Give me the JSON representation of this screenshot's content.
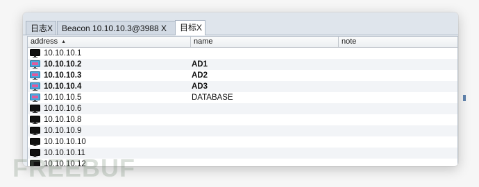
{
  "tabs": [
    {
      "label": "日志X"
    },
    {
      "label": "Beacon 10.10.10.3@3988   X"
    },
    {
      "label": "目标X"
    }
  ],
  "table": {
    "columns": [
      {
        "label": "address",
        "sort": "ascending"
      },
      {
        "label": "name"
      },
      {
        "label": "note"
      }
    ],
    "rows": [
      {
        "address": "10.10.10.1",
        "name": "",
        "note": "",
        "icon": "monitor-icon",
        "bold": false
      },
      {
        "address": "10.10.10.2",
        "name": "AD1",
        "note": "",
        "icon": "compromised-monitor-icon",
        "bold": true
      },
      {
        "address": "10.10.10.3",
        "name": "AD2",
        "note": "",
        "icon": "compromised-monitor-icon",
        "bold": true
      },
      {
        "address": "10.10.10.4",
        "name": "AD3",
        "note": "",
        "icon": "compromised-monitor-icon",
        "bold": true
      },
      {
        "address": "10.10.10.5",
        "name": "DATABASE",
        "note": "",
        "icon": "compromised-monitor-icon",
        "bold": false
      },
      {
        "address": "10.10.10.6",
        "name": "",
        "note": "",
        "icon": "monitor-icon",
        "bold": false
      },
      {
        "address": "10.10.10.8",
        "name": "",
        "note": "",
        "icon": "monitor-icon",
        "bold": false
      },
      {
        "address": "10.10.10.9",
        "name": "",
        "note": "",
        "icon": "monitor-icon",
        "bold": false
      },
      {
        "address": "10.10.10.10",
        "name": "",
        "note": "",
        "icon": "monitor-icon",
        "bold": false
      },
      {
        "address": "10.10.10.11",
        "name": "",
        "note": "",
        "icon": "monitor-icon",
        "bold": false
      },
      {
        "address": "10.10.10.12",
        "name": "",
        "note": "",
        "icon": "monitor-icon",
        "bold": false
      }
    ]
  },
  "colors": {
    "monitor": "#111111",
    "compromised_screen": "#4aa8e0",
    "compromised_accent": "#e05a9b"
  },
  "watermark": {
    "text": "FREEBUF"
  }
}
